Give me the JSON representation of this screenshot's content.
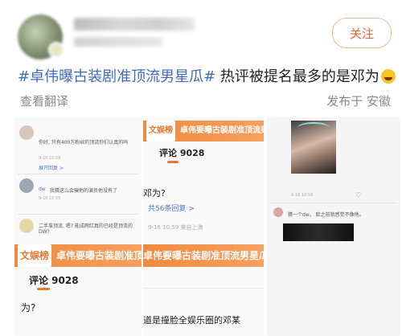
{
  "header": {
    "follow_label": "关注"
  },
  "post": {
    "hashtag": "#卓伟曝古装剧准顶流男星瓜#",
    "text": " 热评被提名最多的是邓为",
    "translate_label": "查看翻译",
    "location_label": "发布于 安徽"
  },
  "screenshot1": {
    "c1_text": "你好, 只有400万粉丝的顶流你们认真的吗",
    "c1_time": "9-16 10:59",
    "c1_reply": "展开回复 >",
    "c2_user": "dw",
    "c2_text": "我猜这么会骗他的演员他没有了",
    "c2_time": "9-16 10:55",
    "c3_text": "二手准顶流, 嗯? 能成网红真的已经是顶流的DW?",
    "banner_tag": "文娱榜",
    "banner_text": "卓伟要曝古装剧准顶流男星几",
    "comments_label": "评论 9028",
    "partial_text": "为?"
  },
  "screenshot2": {
    "banner_tag": "文娱榜",
    "banner_text": "卓伟要曝古装剧准顶流男星瓜",
    "comments_label": "评论 9028",
    "question": "邓为?",
    "replies_label": "共56条回复 >",
    "reply_time": "9-16 10:59 来自上海",
    "bottom_text": "道是撞脸全娱乐圈的邓某"
  },
  "screenshot3": {
    "meta_time": "9-16 10:58",
    "comment_text": "猜一个dw。 脸之前就感觉不像他。",
    "meta_time2": "9-16 10:58"
  }
}
